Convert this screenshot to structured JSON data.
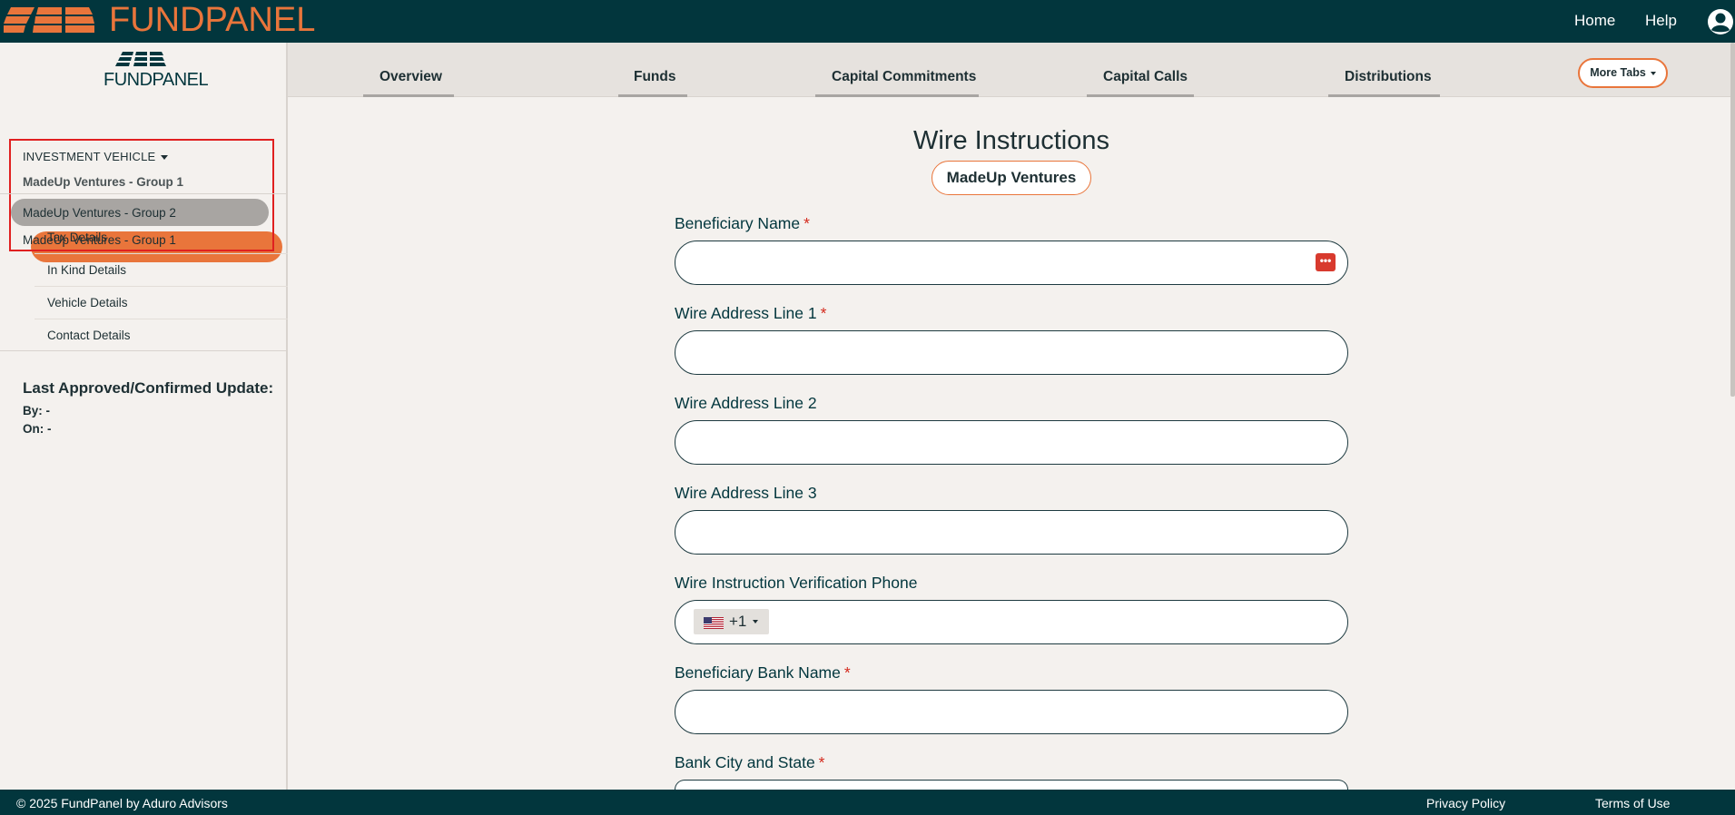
{
  "topbar": {
    "brand_fund": "FUND",
    "brand_panel": "PANEL",
    "nav": [
      {
        "label": "Home"
      },
      {
        "label": "Help"
      }
    ],
    "user_icon": "user-circle-icon"
  },
  "sidebar": {
    "logo_text": "FUNDPANEL",
    "investment_vehicle": {
      "label": "INVESTMENT VEHICLE",
      "current": "MadeUp Ventures - Group 1",
      "options": [
        {
          "label": "MadeUp Ventures - Group 2",
          "selected": true
        },
        {
          "label": "MadeUp Ventures - Group 1",
          "selected": false
        }
      ]
    },
    "menu": [
      {
        "label": "Tax Details"
      },
      {
        "label": "In Kind Details"
      },
      {
        "label": "Vehicle Details"
      },
      {
        "label": "Contact Details"
      }
    ],
    "last_update": {
      "title": "Last Approved/Confirmed Update:",
      "by": "By: -",
      "on": "On: -"
    }
  },
  "tabs": [
    {
      "label": "Overview"
    },
    {
      "label": "Funds"
    },
    {
      "label": "Capital Commitments"
    },
    {
      "label": "Capital Calls"
    },
    {
      "label": "Distributions"
    }
  ],
  "more_tabs_label": "More Tabs",
  "main": {
    "title": "Wire Instructions",
    "fund": "MadeUp Ventures",
    "fields": [
      {
        "label": "Beneficiary Name",
        "required": "*",
        "value": ""
      },
      {
        "label": "Wire Address Line 1",
        "required": "*",
        "value": ""
      },
      {
        "label": "Wire Address Line 2",
        "required": "",
        "value": ""
      },
      {
        "label": "Wire Address Line 3",
        "required": "",
        "value": ""
      },
      {
        "label": "Wire Instruction Verification Phone",
        "required": "",
        "value": ""
      },
      {
        "label": "Beneficiary Bank Name",
        "required": "*",
        "value": ""
      },
      {
        "label": "Bank City and State",
        "required": "*",
        "value": ""
      }
    ],
    "phone_country_code": "+1",
    "password_manager_icon": "password-manager-icon"
  },
  "footer": {
    "copyright": "© 2025 FundPanel by Aduro Advisors",
    "privacy": "Privacy Policy",
    "terms": "Terms of Use"
  },
  "colors": {
    "primary_dark": "#02363d",
    "accent": "#e9753b",
    "required": "#d42a1d",
    "highlight_box": "#e02020"
  }
}
